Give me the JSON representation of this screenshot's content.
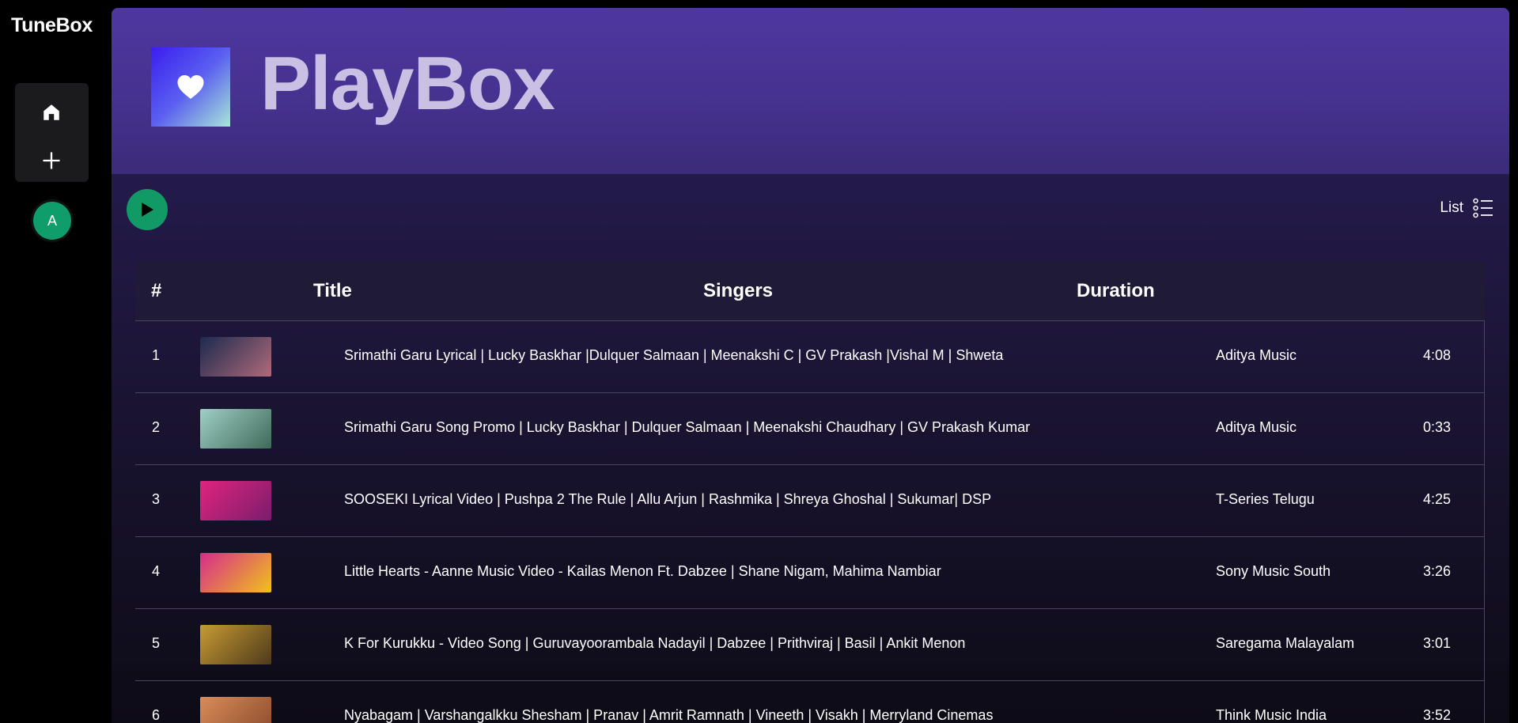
{
  "app": {
    "brand": "TuneBox"
  },
  "sidebar": {
    "home_icon": "home-icon",
    "add_icon": "plus-icon",
    "avatar_initial": "A"
  },
  "playlist": {
    "title": "PlayBox",
    "cover_icon": "heart-icon"
  },
  "controls": {
    "view_label": "List",
    "view_icon": "list-view-icon",
    "play_icon": "play-icon"
  },
  "table": {
    "headers": {
      "num": "#",
      "title": "Title",
      "singers": "Singers",
      "duration": "Duration"
    },
    "rows": [
      {
        "index": "1",
        "title": "Srimathi Garu Lyrical | Lucky Baskhar |Dulquer Salmaan | Meenakshi C | GV Prakash |Vishal M | Shweta",
        "artist": "Aditya Music",
        "duration": "4:08",
        "thumb": [
          "#1c2a4e",
          "#b06a7a"
        ]
      },
      {
        "index": "2",
        "title": "Srimathi Garu Song Promo | Lucky Baskhar | Dulquer Salmaan | Meenakshi Chaudhary | GV Prakash Kumar",
        "artist": "Aditya Music",
        "duration": "0:33",
        "thumb": [
          "#9fd0c6",
          "#3f6a5a"
        ]
      },
      {
        "index": "3",
        "title": "SOOSEKI Lyrical Video | Pushpa 2 The Rule | Allu Arjun | Rashmika | Shreya Ghoshal | Sukumar| DSP",
        "artist": "T-Series Telugu",
        "duration": "4:25",
        "thumb": [
          "#e0247c",
          "#7a1d6e"
        ]
      },
      {
        "index": "4",
        "title": "Little Hearts - Aanne Music Video - Kailas Menon Ft. Dabzee | Shane Nigam, Mahima Nambiar",
        "artist": "Sony Music South",
        "duration": "3:26",
        "thumb": [
          "#d62c8a",
          "#f1c21b"
        ]
      },
      {
        "index": "5",
        "title": "K For Kurukku - Video Song | Guruvayoorambala Nadayil | Dabzee | Prithviraj | Basil | Ankit Menon",
        "artist": "Saregama Malayalam",
        "duration": "3:01",
        "thumb": [
          "#c79a33",
          "#4e3a1c"
        ]
      },
      {
        "index": "6",
        "title": "Nyabagam | Varshangalkku Shesham | Pranav | Amrit Ramnath | Vineeth | Visakh | Merryland Cinemas",
        "artist": "Think Music India",
        "duration": "3:52",
        "thumb": [
          "#d98c5a",
          "#8a4a2a"
        ]
      }
    ]
  }
}
